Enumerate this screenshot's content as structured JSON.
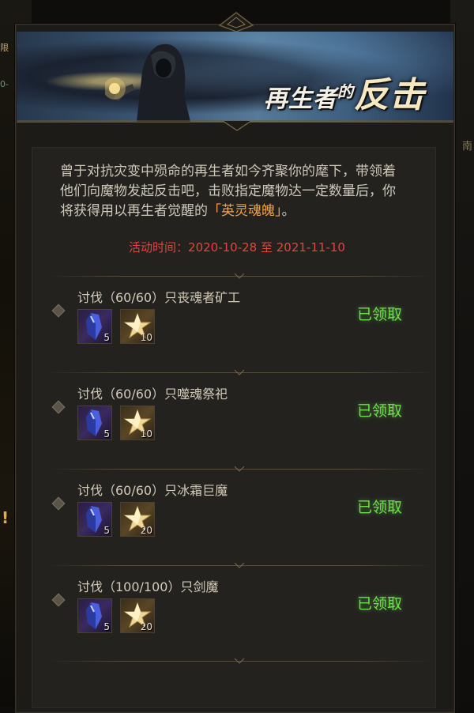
{
  "background": {
    "left_text_1": "限",
    "left_text_2": "0-",
    "right_glyph_1": "南"
  },
  "banner": {
    "title_part1": "再生者",
    "title_part2": "的",
    "title_part3": "反击"
  },
  "description": {
    "text_before": "曾于对抗灾变中殒命的再生者如今齐聚你的麾下，带领着他们向魔物发起反击吧，击败指定魔物达一定数量后，你将获得用以再生者觉醒的",
    "highlight": "「英灵魂魄」",
    "text_after": "。"
  },
  "period": {
    "label": "活动时间：2020-10-28 至 2021-11-10"
  },
  "tasks": [
    {
      "name": "讨伐（60/60）只丧魂者矿工",
      "rewards": [
        {
          "icon": "purple-crystal-icon",
          "count": "5"
        },
        {
          "icon": "gold-star-icon",
          "count": "10"
        }
      ],
      "status": "已领取"
    },
    {
      "name": "讨伐（60/60）只噬魂祭祀",
      "rewards": [
        {
          "icon": "purple-crystal-icon",
          "count": "5"
        },
        {
          "icon": "gold-star-icon",
          "count": "10"
        }
      ],
      "status": "已领取"
    },
    {
      "name": "讨伐（60/60）只冰霜巨魔",
      "rewards": [
        {
          "icon": "purple-crystal-icon",
          "count": "5"
        },
        {
          "icon": "gold-star-icon",
          "count": "20"
        }
      ],
      "status": "已领取"
    },
    {
      "name": "讨伐（100/100）只剑魔",
      "rewards": [
        {
          "icon": "purple-crystal-icon",
          "count": "5"
        },
        {
          "icon": "gold-star-icon",
          "count": "20"
        }
      ],
      "status": "已领取"
    }
  ],
  "colors": {
    "accent_orange": "#f2a24a",
    "period_red": "#e0463c",
    "claimed_green": "#6ce04a"
  }
}
